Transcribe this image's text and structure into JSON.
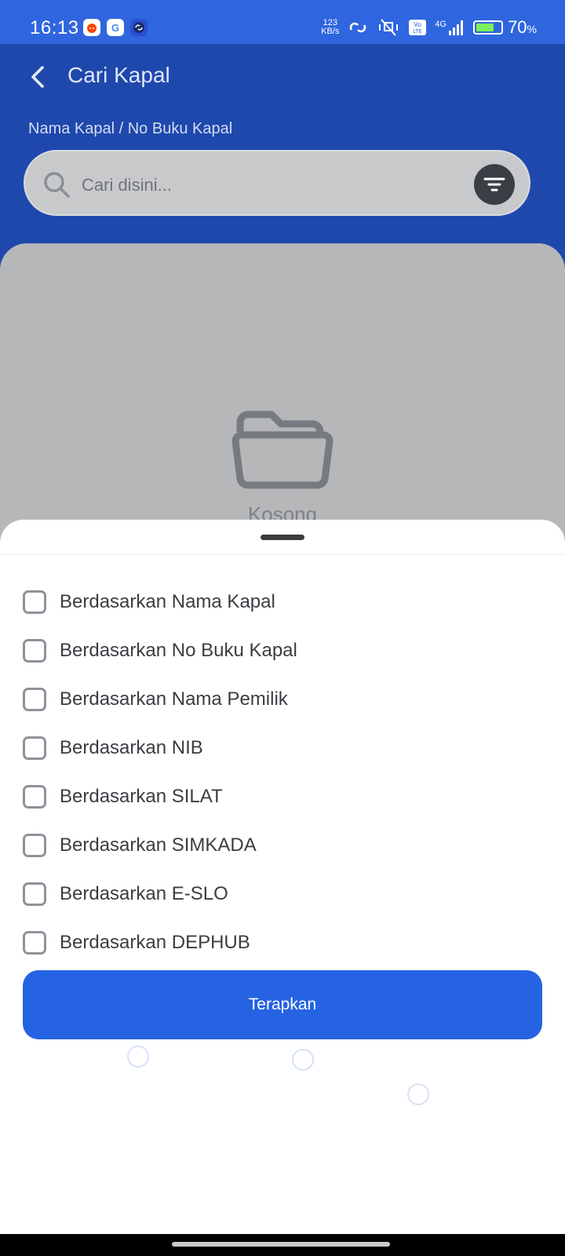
{
  "status_bar": {
    "time": "16:13",
    "net_speed_value": "123",
    "net_speed_unit": "KB/s",
    "network": "4G",
    "battery_percent": "70",
    "battery_unit": "%",
    "notification_icons": [
      "reddit-icon",
      "google-icon",
      "link-app-icon"
    ]
  },
  "header": {
    "title": "Cari Kapal",
    "search_label": "Nama Kapal / No Buku Kapal",
    "search_placeholder": "Cari disini..."
  },
  "empty_state": {
    "text": "Kosong"
  },
  "filter_sheet": {
    "options": [
      {
        "label": "Berdasarkan Nama Kapal",
        "checked": false
      },
      {
        "label": "Berdasarkan No Buku Kapal",
        "checked": false
      },
      {
        "label": "Berdasarkan Nama Pemilik",
        "checked": false
      },
      {
        "label": "Berdasarkan NIB",
        "checked": false
      },
      {
        "label": "Berdasarkan SILAT",
        "checked": false
      },
      {
        "label": "Berdasarkan SIMKADA",
        "checked": false
      },
      {
        "label": "Berdasarkan E-SLO",
        "checked": false
      },
      {
        "label": "Berdasarkan DEPHUB",
        "checked": false
      }
    ],
    "apply_label": "Terapkan"
  },
  "colors": {
    "header_bg": "#1f48ad",
    "status_bar_bg": "#2f66df",
    "primary_button": "#2563e3"
  }
}
